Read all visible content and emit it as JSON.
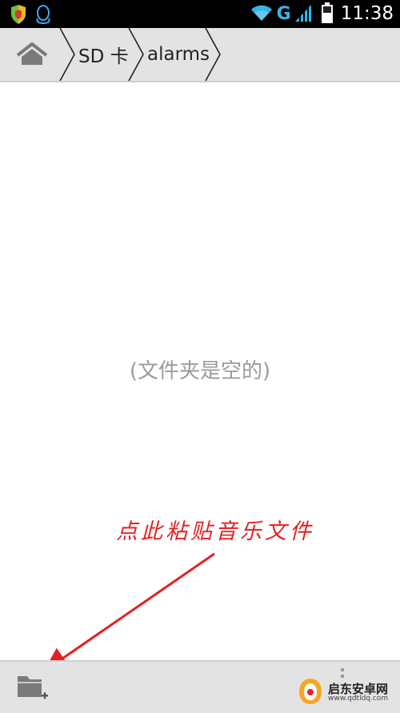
{
  "status_bar": {
    "network_label": "G",
    "time": "11:38"
  },
  "breadcrumb": {
    "items": [
      "SD 卡",
      "alarms"
    ]
  },
  "empty_message": "(文件夹是空的)",
  "annotation": {
    "text": "点此粘贴音乐文件",
    "color": "#e62020"
  },
  "icons": {
    "home": "home-icon",
    "new_folder": "folder-plus-icon",
    "shield": "shield-icon",
    "qq": "qq-penguin-icon",
    "wifi": "wifi-icon",
    "signal": "signal-icon",
    "battery": "battery-icon"
  },
  "watermark": {
    "title": "启东安卓网",
    "url": "www.qdtldq.com"
  }
}
